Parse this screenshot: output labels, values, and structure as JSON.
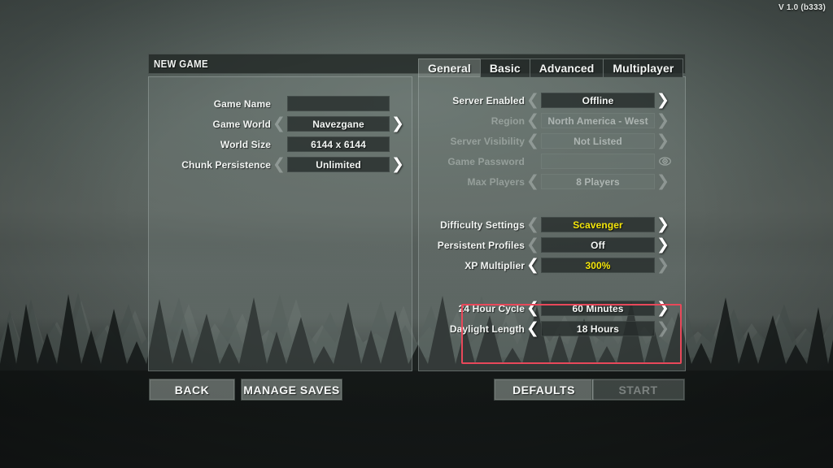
{
  "version": "V 1.0 (b333)",
  "window": {
    "title": "NEW GAME"
  },
  "left_panel": {
    "rows": [
      {
        "label": "Game Name",
        "value": "",
        "has_arrows": false,
        "type": "input"
      },
      {
        "label": "Game World",
        "value": "Navezgane",
        "has_arrows": true,
        "type": "stepper"
      },
      {
        "label": "World Size",
        "value": "6144 x 6144",
        "has_arrows": false,
        "type": "readonly"
      },
      {
        "label": "Chunk Persistence",
        "value": "Unlimited",
        "has_arrows": true,
        "type": "stepper"
      }
    ]
  },
  "tabs": [
    {
      "label": "General",
      "active": true
    },
    {
      "label": "Basic",
      "active": false
    },
    {
      "label": "Advanced",
      "active": false
    },
    {
      "label": "Multiplayer",
      "active": false
    }
  ],
  "right_panel": {
    "group_server": [
      {
        "label": "Server Enabled",
        "value": "Offline",
        "disabled": false,
        "left_arrow": "dim",
        "right_arrow": "bright"
      },
      {
        "label": "Region",
        "value": "North America - West",
        "disabled": true,
        "left_arrow": "dim",
        "right_arrow": "dim"
      },
      {
        "label": "Server Visibility",
        "value": "Not Listed",
        "disabled": true,
        "left_arrow": "dim",
        "right_arrow": "dim"
      },
      {
        "label": "Game Password",
        "value": "",
        "disabled": true,
        "icon": "eye-icon"
      },
      {
        "label": "Max Players",
        "value": "8 Players",
        "disabled": true,
        "left_arrow": "dim",
        "right_arrow": "dim"
      }
    ],
    "group_difficulty": [
      {
        "label": "Difficulty Settings",
        "value": "Scavenger",
        "highlight": true,
        "left_arrow": "dim",
        "right_arrow": "bright"
      },
      {
        "label": "Persistent Profiles",
        "value": "Off",
        "highlight": false,
        "left_arrow": "dim",
        "right_arrow": "bright"
      },
      {
        "label": "XP Multiplier",
        "value": "300%",
        "highlight": true,
        "left_arrow": "bright",
        "right_arrow": "dim"
      }
    ],
    "group_time": [
      {
        "label": "24 Hour Cycle",
        "value": "60 Minutes",
        "left_arrow": "bright",
        "right_arrow": "bright"
      },
      {
        "label": "Daylight Length",
        "value": "18 Hours",
        "left_arrow": "bright",
        "right_arrow": "dim"
      }
    ]
  },
  "buttons": {
    "back": "BACK",
    "manage_saves": "MANAGE SAVES",
    "defaults": "DEFAULTS",
    "start": "START"
  },
  "colors": {
    "highlight_value": "#f5e60a",
    "annotation_box": "#e8485a",
    "text": "#f4f7f5"
  },
  "glyphs": {
    "left_arrow": "❮",
    "right_arrow": "❯"
  }
}
